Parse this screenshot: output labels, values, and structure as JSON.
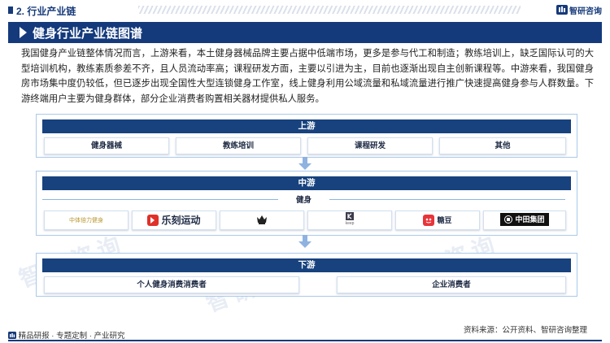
{
  "header": {
    "section_label": "2. 行业产业链",
    "brand_name": "智研咨询"
  },
  "title": "健身行业产业链图谱",
  "intro": "我国健身产业链整体情况而言，上游来看，本土健身器械品牌主要占据中低端市场，更多是参与代工和制造；教练培训上，缺乏国际认可的大型培训机构，教练素质参差不齐，且人员流动率高；课程研发方面，主要以引进为主，目前也逐渐出现自主创新课程等。中游来看，我国健身房市场集中度仍较低，但已逐步出现全国性大型连锁健身工作室，线上健身利用公域流量和私域流量进行推广快速提高健身参与人群数量。下游终端用户主要为健身群体，部分企业消费者购置相关器材提供私人服务。",
  "upstream": {
    "label": "上游",
    "items": [
      "健身器械",
      "教练培训",
      "课程研发",
      "其他"
    ]
  },
  "midstream": {
    "label": "中游",
    "sublabel": "健身",
    "logos": [
      {
        "text": "中体倍力健身",
        "icon": "sports-logo"
      },
      {
        "text": "乐刻运动",
        "icon": "lefit-logo"
      },
      {
        "text": "",
        "icon": "crown-logo"
      },
      {
        "text": "keep",
        "icon": "keep-logo"
      },
      {
        "text": "糖豆",
        "icon": "tangdou-logo"
      },
      {
        "text": "中田集团",
        "icon": "zhongtian-logo"
      }
    ]
  },
  "downstream": {
    "label": "下游",
    "items": [
      "个人健身消费消费者",
      "企业消费者"
    ]
  },
  "footer": {
    "left": "精品研报 · 专题定制 · 产业研究",
    "right": "资料来源：公开资料、智研咨询整理"
  },
  "watermark": "智研咨询",
  "colors": {
    "primary": "#143a7c",
    "accent_light": "#8fb3e0",
    "lefit_red": "#e0302a"
  }
}
